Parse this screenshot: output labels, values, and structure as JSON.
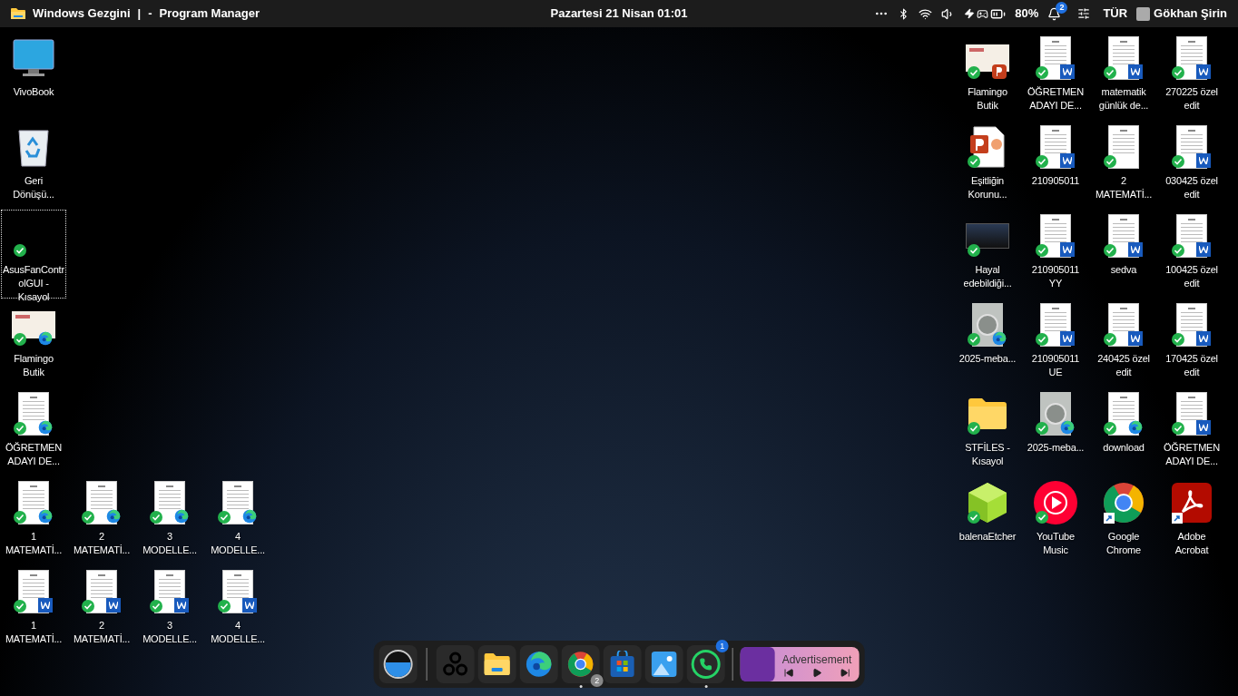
{
  "top_bar": {
    "app_title": "Windows Gezgini",
    "separator": "|",
    "dash": "-",
    "window_title": "Program Manager",
    "clock": "Pazartesi 21 Nisan 01:01",
    "battery_percent": "80%",
    "notification_count": "2",
    "language": "TÜR",
    "user": "Gökhan Şirin"
  },
  "left_icons": [
    [
      {
        "label": "VivoBook",
        "kind": "monitor",
        "synced": false,
        "shortcut": false,
        "selected": false
      }
    ],
    [
      {
        "label": "Geri Dönüşü...",
        "kind": "recycle",
        "synced": false,
        "shortcut": false,
        "selected": false
      }
    ],
    [
      {
        "label": "AsusFanControlGUI - Kısayol",
        "kind": "blank",
        "synced": true,
        "shortcut": false,
        "selected": true
      }
    ],
    [
      {
        "label": "Flamingo Butik",
        "kind": "slide",
        "badge": {
          "kind": "edge"
        },
        "synced": true,
        "shortcut": false,
        "selected": false
      }
    ],
    [
      {
        "label": "ÖĞRETMEN ADAYI DE...",
        "kind": "doc",
        "badge": {
          "kind": "edge"
        },
        "synced": true,
        "shortcut": false,
        "selected": false
      }
    ],
    [
      {
        "label": "1 MATEMATİ...",
        "kind": "doc",
        "badge": {
          "kind": "edge"
        },
        "synced": true,
        "shortcut": false,
        "selected": false
      },
      {
        "label": "2 MATEMATİ...",
        "kind": "doc",
        "badge": {
          "kind": "edge"
        },
        "synced": true,
        "shortcut": false,
        "selected": false
      },
      {
        "label": "3 MODELLE...",
        "kind": "doc",
        "badge": {
          "kind": "edge"
        },
        "synced": true,
        "shortcut": false,
        "selected": false
      },
      {
        "label": "4 MODELLE...",
        "kind": "doc",
        "badge": {
          "kind": "edge"
        },
        "synced": true,
        "shortcut": false,
        "selected": false
      }
    ],
    [
      {
        "label": "1 MATEMATİ...",
        "kind": "doc",
        "badge": {
          "kind": "word"
        },
        "synced": true,
        "shortcut": false,
        "selected": false
      },
      {
        "label": "2 MATEMATİ...",
        "kind": "doc",
        "badge": {
          "kind": "word"
        },
        "synced": true,
        "shortcut": false,
        "selected": false
      },
      {
        "label": "3 MODELLE...",
        "kind": "doc",
        "badge": {
          "kind": "word"
        },
        "synced": true,
        "shortcut": false,
        "selected": false
      },
      {
        "label": "4 MODELLE...",
        "kind": "doc",
        "badge": {
          "kind": "word"
        },
        "synced": true,
        "shortcut": false,
        "selected": false
      }
    ]
  ],
  "right_icons": [
    {
      "label": "Flamingo Butik",
      "kind": "slide",
      "badge": {
        "kind": "ppt"
      },
      "synced": true,
      "shortcut": false,
      "selected": false
    },
    {
      "label": "ÖĞRETMEN ADAYI DE...",
      "kind": "doc",
      "badge": {
        "kind": "word"
      },
      "synced": true,
      "shortcut": false,
      "selected": false
    },
    {
      "label": "matematik günlük de...",
      "kind": "doc",
      "badge": {
        "kind": "word"
      },
      "synced": true,
      "shortcut": false,
      "selected": false
    },
    {
      "label": "270225 özel edit",
      "kind": "doc",
      "badge": {
        "kind": "word"
      },
      "synced": true,
      "shortcut": false,
      "selected": false
    },
    {
      "label": "Eşitliğin Korunu...",
      "kind": "ppt-file",
      "synced": true,
      "shortcut": false,
      "selected": false
    },
    {
      "label": "210905011",
      "kind": "doc",
      "badge": {
        "kind": "word"
      },
      "synced": true,
      "shortcut": false,
      "selected": false
    },
    {
      "label": "2 MATEMATİ...",
      "kind": "doc",
      "synced": true,
      "shortcut": false,
      "selected": false
    },
    {
      "label": "030425 özel edit",
      "kind": "doc",
      "badge": {
        "kind": "word"
      },
      "synced": true,
      "shortcut": false,
      "selected": false
    },
    {
      "label": "Hayal edebildiği...",
      "kind": "video",
      "synced": true,
      "shortcut": false,
      "selected": false
    },
    {
      "label": "210905011 YY",
      "kind": "doc",
      "badge": {
        "kind": "word"
      },
      "synced": true,
      "shortcut": false,
      "selected": false
    },
    {
      "label": "sedva",
      "kind": "doc",
      "badge": {
        "kind": "word"
      },
      "synced": true,
      "shortcut": false,
      "selected": false
    },
    {
      "label": "100425 özel edit",
      "kind": "doc",
      "badge": {
        "kind": "word"
      },
      "synced": true,
      "shortcut": false,
      "selected": false
    },
    {
      "label": "2025-meba...",
      "kind": "gauge",
      "badge": {
        "kind": "edge"
      },
      "synced": true,
      "shortcut": false,
      "selected": false
    },
    {
      "label": "210905011 UE",
      "kind": "doc",
      "badge": {
        "kind": "word"
      },
      "synced": true,
      "shortcut": false,
      "selected": false
    },
    {
      "label": "240425 özel edit",
      "kind": "doc",
      "badge": {
        "kind": "word"
      },
      "synced": true,
      "shortcut": false,
      "selected": false
    },
    {
      "label": "170425 özel edit",
      "kind": "doc",
      "badge": {
        "kind": "word"
      },
      "synced": true,
      "shortcut": false,
      "selected": false
    },
    {
      "label": "STFİLES - Kısayol",
      "kind": "folder",
      "synced": true,
      "shortcut": false,
      "selected": false
    },
    {
      "label": "2025-meba...",
      "kind": "gauge",
      "badge": {
        "kind": "edge"
      },
      "synced": true,
      "shortcut": false,
      "selected": false
    },
    {
      "label": "download",
      "kind": "doc",
      "badge": {
        "kind": "edge"
      },
      "synced": true,
      "shortcut": false,
      "selected": false
    },
    {
      "label": "ÖĞRETMEN ADAYI DE...",
      "kind": "doc",
      "badge": {
        "kind": "word"
      },
      "synced": true,
      "shortcut": false,
      "selected": false
    },
    {
      "label": "balenaEtcher",
      "kind": "balena",
      "synced": true,
      "shortcut": false,
      "selected": false
    },
    {
      "label": "YouTube Music",
      "kind": "ytmusic",
      "synced": true,
      "shortcut": false,
      "selected": false
    },
    {
      "label": "Google Chrome",
      "kind": "chrome",
      "synced": false,
      "shortcut": true,
      "selected": false
    },
    {
      "label": "Adobe Acrobat",
      "kind": "acrobat",
      "synced": false,
      "shortcut": true,
      "selected": false
    }
  ],
  "dock": {
    "apps": [
      {
        "kind": "water",
        "running": false
      },
      {
        "kind": "fan",
        "running": false
      },
      {
        "kind": "explorer",
        "running": false
      },
      {
        "kind": "edge",
        "running": false
      },
      {
        "kind": "chrome",
        "badge": "2",
        "running": true
      },
      {
        "kind": "store",
        "running": false
      },
      {
        "kind": "photos",
        "running": false
      },
      {
        "kind": "whatsapp",
        "badge": "1",
        "running": true
      }
    ],
    "media": {
      "label": "Advertisement"
    }
  }
}
